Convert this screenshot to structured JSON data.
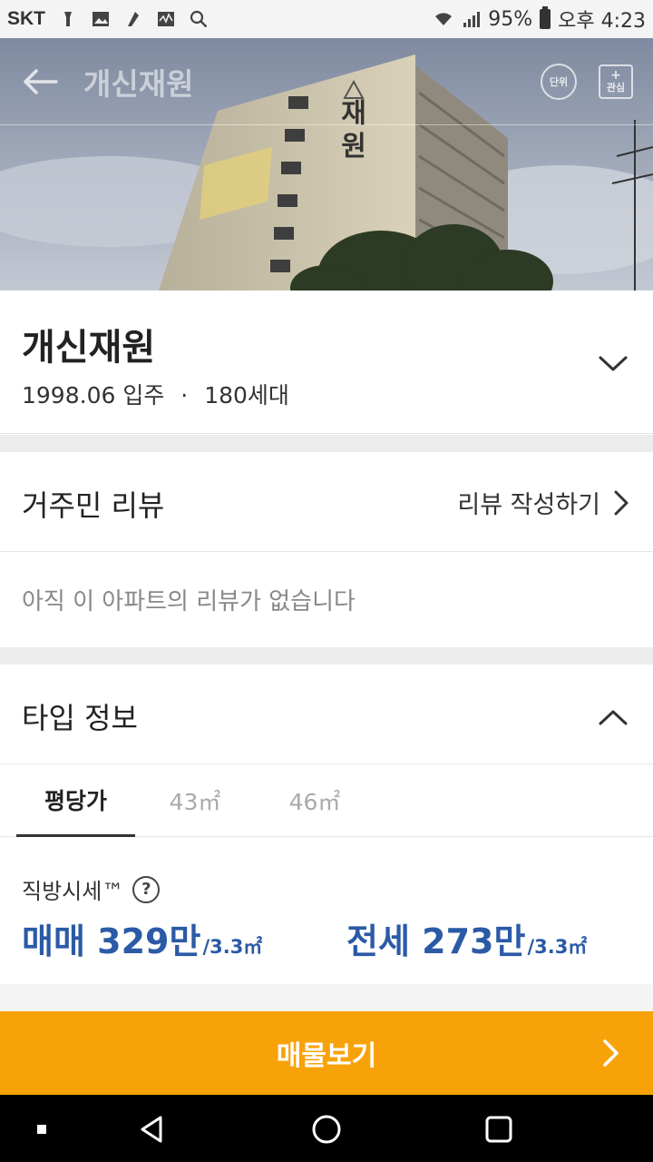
{
  "status_bar": {
    "carrier": "SKT",
    "battery": "95%",
    "time": "오후 4:23",
    "icons": [
      "flashlight-icon",
      "gallery-icon",
      "app-icon",
      "activity-icon",
      "search-icon",
      "wifi-icon",
      "signal-icon",
      "battery-icon"
    ]
  },
  "hero": {
    "title": "개신재원",
    "unit_label": "단위",
    "fav_plus": "+",
    "fav_label": "관심",
    "sign_top": "재",
    "sign_bottom": "원"
  },
  "summary": {
    "name": "개신재원",
    "move_in": "1998.06 입주",
    "separator": "·",
    "households": "180세대"
  },
  "review": {
    "title": "거주민 리뷰",
    "write_label": "리뷰 작성하기",
    "empty_text": "아직 이 아파트의 리뷰가 없습니다"
  },
  "type_info": {
    "title": "타입 정보",
    "tabs": [
      {
        "label": "평당가",
        "active": true
      },
      {
        "label": "43㎡",
        "active": false
      },
      {
        "label": "46㎡",
        "active": false
      }
    ],
    "price_label": "직방시세™",
    "help_symbol": "?",
    "sale": {
      "label": "매매 329만",
      "unit": "/3.3㎡"
    },
    "jeonse": {
      "label": "전세 273만",
      "unit": "/3.3㎡"
    }
  },
  "cta": {
    "label": "매물보기"
  },
  "colors": {
    "accent": "#f8a20a",
    "price_blue": "#2b5aa6"
  }
}
